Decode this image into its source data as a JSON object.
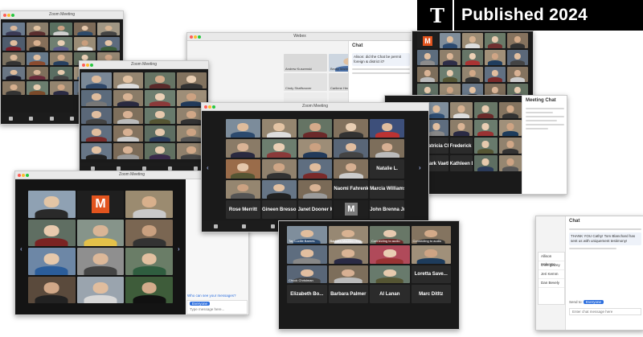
{
  "badge": {
    "logo": "T",
    "label": "Published 2024"
  },
  "windows": {
    "w1": {
      "title": "Zoom Meeting"
    },
    "w2": {
      "title": "Zoom Meeting"
    },
    "w3": {
      "title": "Zoom Meeting"
    },
    "w4": {
      "title": "Zoom Meeting"
    },
    "w5": {
      "title": "Webex"
    }
  },
  "chat_top": {
    "title": "Chat",
    "msg": "Alison: did the Chat be permit foreign & district it?",
    "names": [
      "Andrew Kuszenski",
      "Becky Madden",
      "Cindy Shaffsnover",
      "Carilene Henninsey"
    ]
  },
  "center_names": [
    "Rose Merritt",
    "Gineen Bresso",
    "Janet Dooner Mo...",
    "M",
    "John Brenna Jr",
    "Naomi Fahrenkrug",
    "Marcia Williams",
    "Natalie L."
  ],
  "bottom_names": [
    "Elizabeth Bo...",
    "Barbara Palmer",
    "Al Lanan",
    "Marc Ditltz",
    "Loretta Save...",
    "Chuck Christman"
  ],
  "bottom_header": [
    "Tay Lucille Barnes",
    "Barbara Madden Hug...",
    "Connecting to audio",
    "Connecting to audio"
  ],
  "left_big": {
    "title": "Zoom Meeting"
  },
  "right_chat": {
    "title": "Chat",
    "msg": "THANK YOU Cathy! Tom Blanchard has sent us with uniquement testimony!",
    "to_label": "Send to:",
    "to_value": "Everyone",
    "placeholder": "Enter chat message here"
  },
  "who_prompt": "Who can see your messages?",
  "left_input": {
    "to": "Everyone",
    "placeholder": "Type message here..."
  },
  "people_right": [
    "Allison Halvorse",
    "chris glazey",
    "Jeri Kemm",
    "Dan Bevely"
  ],
  "right_top_chat": {
    "title": "Meeting Chat",
    "names": [
      "Patricia Che...",
      "Frederick Ne...",
      "Mark Vaeth",
      "Kathleen Di..."
    ]
  },
  "colors": {
    "accent": "#e2541e",
    "dark": "#1a1a1a",
    "badge": "#000000"
  }
}
